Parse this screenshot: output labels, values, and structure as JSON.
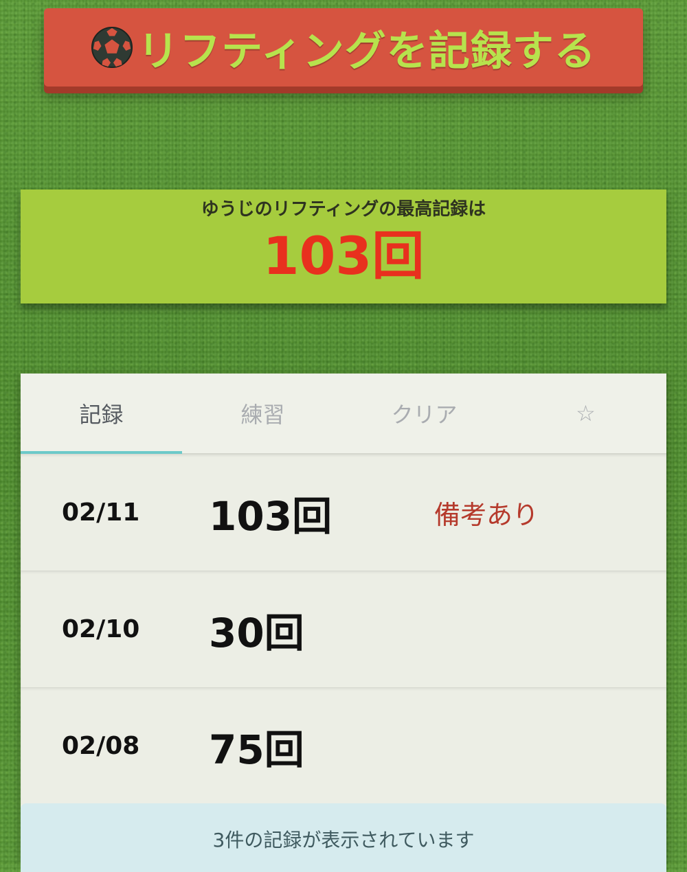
{
  "record_button": {
    "icon": "soccer-ball-icon",
    "label": "リフティングを記録する"
  },
  "best": {
    "caption": "ゆうじのリフティングの最高記録は",
    "value": "103回"
  },
  "tabs": [
    {
      "label": "記録",
      "active": true
    },
    {
      "label": "練習",
      "active": false
    },
    {
      "label": "クリア",
      "active": false
    },
    {
      "label": "☆",
      "active": false
    }
  ],
  "records": [
    {
      "date": "02/11",
      "count": "103回",
      "note": "備考あり"
    },
    {
      "date": "02/10",
      "count": "30回",
      "note": ""
    },
    {
      "date": "02/08",
      "count": "75回",
      "note": ""
    }
  ],
  "footer": {
    "status": "3件の記録が表示されています"
  },
  "colors": {
    "button_bg": "#d65440",
    "button_text": "#b7e34d",
    "best_panel_bg": "#a6cc3e",
    "best_value": "#e8301e",
    "tab_indicator": "#6cc9c9",
    "note_text": "#b53a2c",
    "footer_bg": "#d6ebee"
  }
}
